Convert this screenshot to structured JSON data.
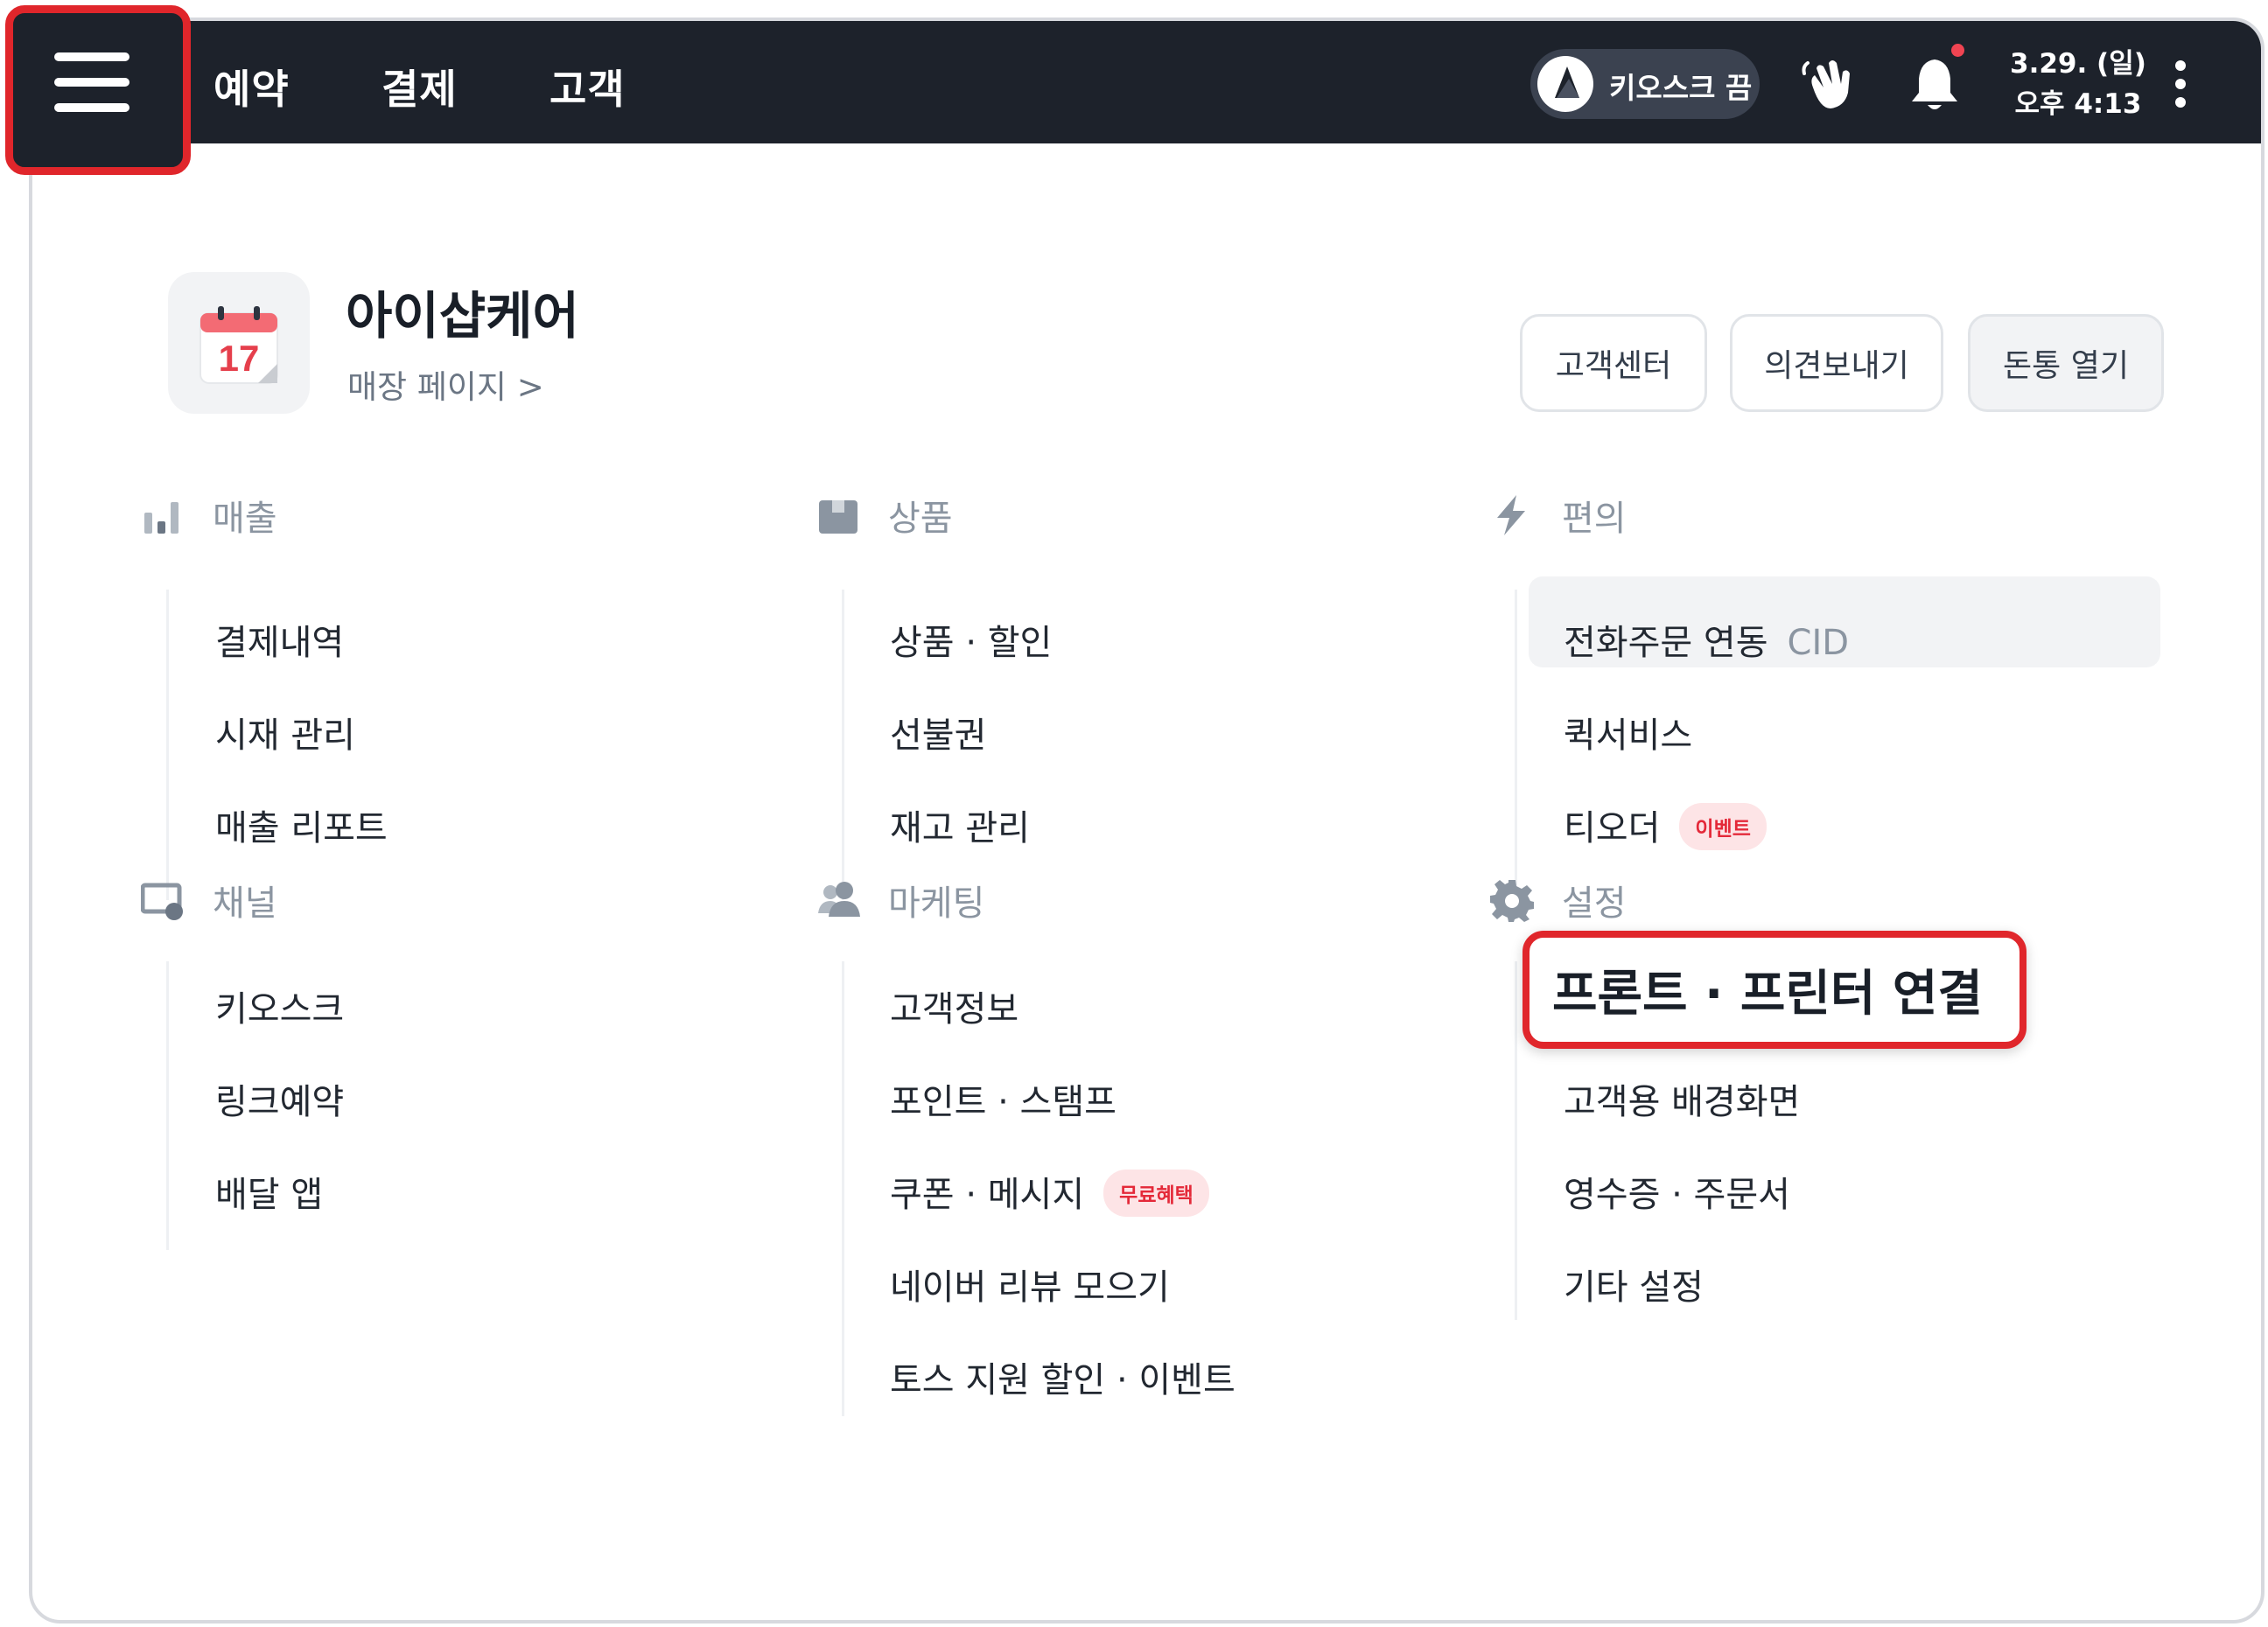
{
  "topbar": {
    "nav": [
      "예약",
      "결제",
      "고객"
    ],
    "kiosk_label": "키오스크 끔",
    "date": "3.29. (일)",
    "time": "오후 4:13"
  },
  "store": {
    "calendar_day": "17",
    "name": "아이샵케어",
    "page_link": "매장 페이지 >"
  },
  "header_buttons": {
    "support": "고객센터",
    "feedback": "의견보내기",
    "cash_drawer": "돈통 열기"
  },
  "sections": {
    "sales": {
      "title": "매출",
      "items": [
        "결제내역",
        "시재 관리",
        "매출 리포트"
      ]
    },
    "products": {
      "title": "상품",
      "items": [
        "상품 · 할인",
        "선불권",
        "재고 관리"
      ]
    },
    "convenience": {
      "title": "편의",
      "phone_order": "전화주문 연동",
      "phone_order_tag": "CID",
      "quick_service": "퀵서비스",
      "t_order": "티오더",
      "t_order_badge": "이벤트"
    },
    "channel": {
      "title": "채널",
      "items": [
        "키오스크",
        "링크예약",
        "배달 앱"
      ]
    },
    "marketing": {
      "title": "마케팅",
      "customer_info": "고객정보",
      "points": "포인트 · 스탬프",
      "coupon": "쿠폰 · 메시지",
      "coupon_badge": "무료혜택",
      "naver_review": "네이버 리뷰 모으기",
      "toss_discount": "토스 지원 할인 · 이벤트"
    },
    "settings": {
      "title": "설정",
      "printer": "프론트 · 프린터 연결",
      "items": [
        "고객용 배경화면",
        "영수증 · 주문서",
        "기타 설정"
      ]
    }
  },
  "colors": {
    "topbar": "#1d222b",
    "highlight": "#e0262b",
    "badge_text": "#e42939",
    "badge_bg": "#fde4e6"
  }
}
